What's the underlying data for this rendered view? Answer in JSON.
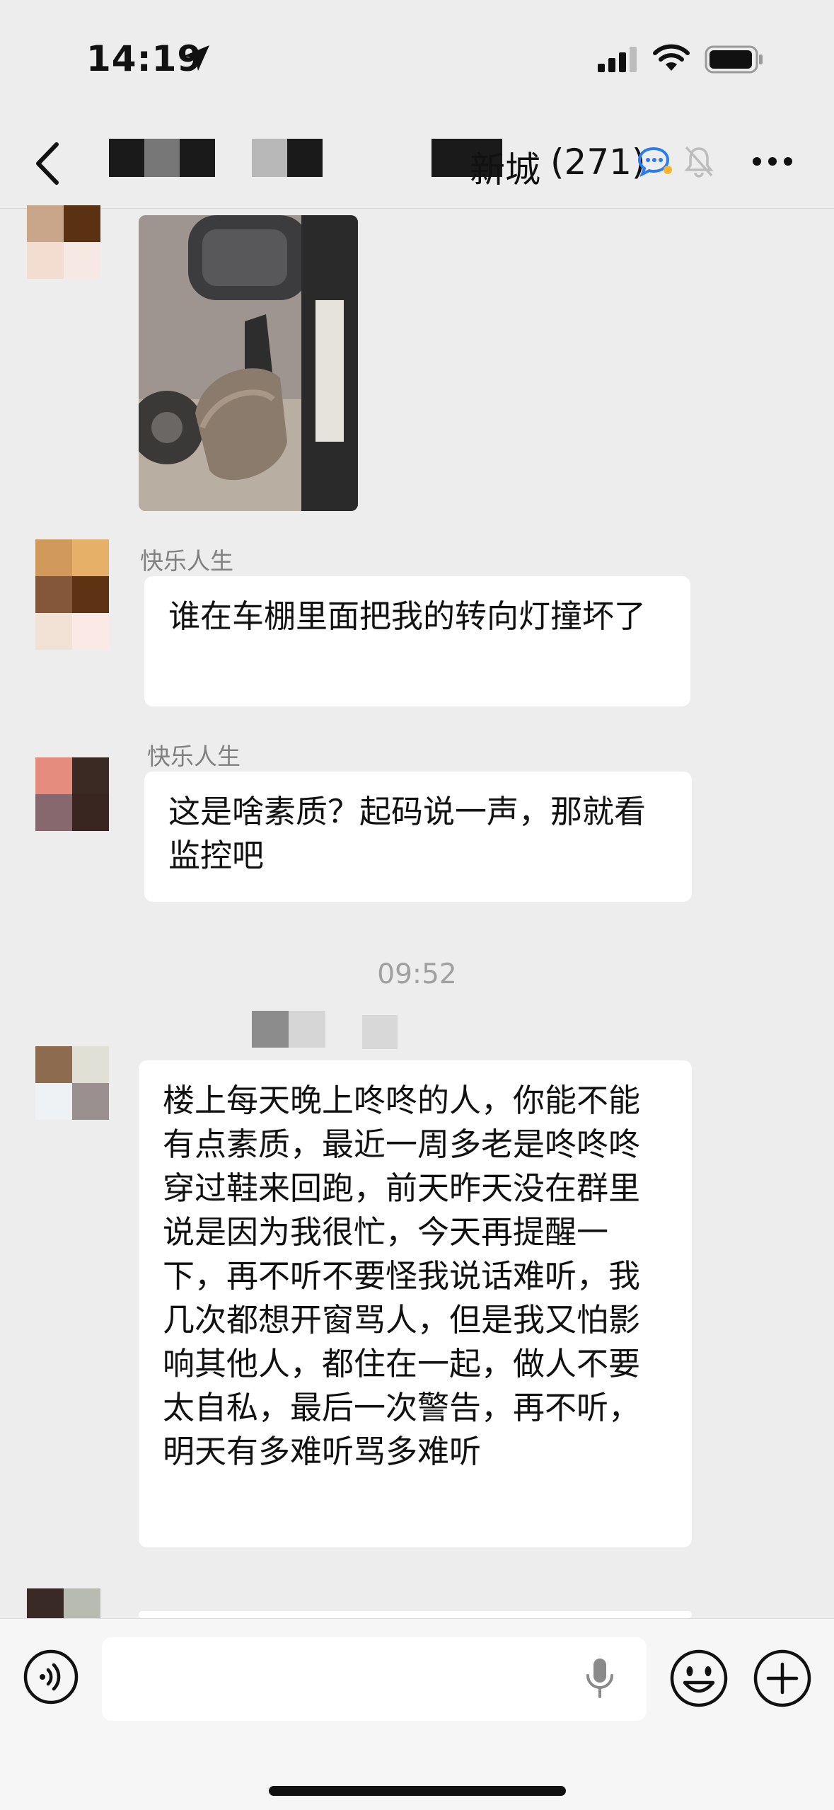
{
  "status_bar": {
    "time": "14:19"
  },
  "nav": {
    "title": "新城",
    "member_count": "(271)",
    "icons": [
      "back-icon",
      "chat-bubble-icon",
      "mute-bell-icon",
      "more-icon"
    ]
  },
  "messages": [
    {
      "type": "image",
      "description_icon": "photo"
    },
    {
      "sender": "快乐人生",
      "text": "谁在车棚里面把我的转向灯撞坏了"
    },
    {
      "sender": "快乐人生",
      "text": "这是啥素质？起码说一声，那就看监控吧"
    },
    {
      "type": "timestamp",
      "text": "09:52"
    },
    {
      "sender": "",
      "text": "楼上每天晚上咚咚的人，你能不能有点素质，最近一周多老是咚咚咚穿过鞋来回跑，前天昨天没在群里说是因为我很忙，今天再提醒一下，再不听不要怪我说话难听，我几次都想开窗骂人，但是我又怕影响其他人，都住在一起，做人不要太自私，最后一次警告，再不听，明天有多难听骂多难听"
    }
  ],
  "input_bar": {
    "placeholder": ""
  },
  "colors": {
    "background": "#ededed",
    "bubble": "#ffffff",
    "accent": "#2b7bf2"
  }
}
